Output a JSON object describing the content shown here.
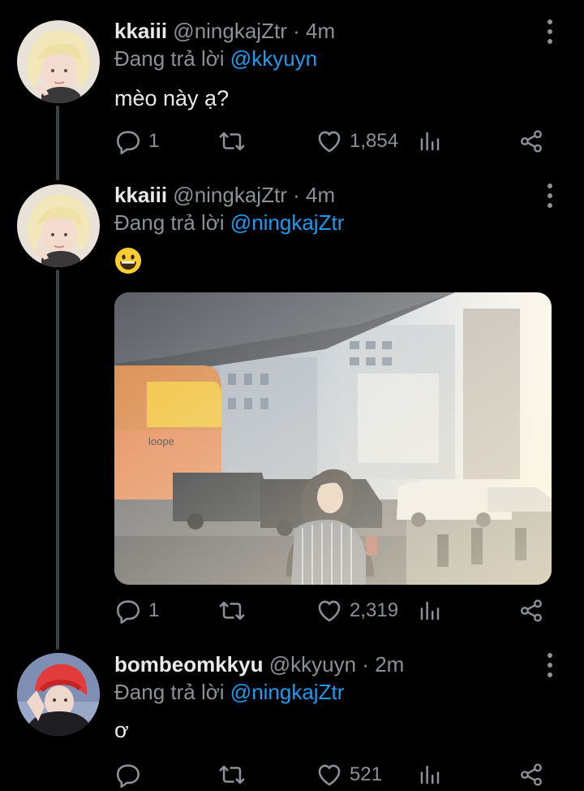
{
  "tweets": [
    {
      "name": "kkaiii",
      "handle": "@ningkajZtr",
      "sep": "·",
      "time": "4m",
      "reply_prefix": "Đang trả lời",
      "reply_to": "@kkyuyn",
      "text": "mèo này ạ?",
      "stats": {
        "replies": "1",
        "likes": "1,854"
      }
    },
    {
      "name": "kkaiii",
      "handle": "@ningkajZtr",
      "sep": "·",
      "time": "4m",
      "reply_prefix": "Đang trả lời",
      "reply_to": "@ningkajZtr",
      "emoji": "grinning-face",
      "media": "photo-street-person",
      "stats": {
        "replies": "1",
        "likes": "2,319"
      }
    },
    {
      "name": "bombeomkkyu",
      "handle": "@kkyuyn",
      "sep": "·",
      "time": "2m",
      "reply_prefix": "Đang trả lời",
      "reply_to": "@ningkajZtr",
      "text": "ơ",
      "stats": {
        "replies": "",
        "likes": "521"
      }
    }
  ],
  "colors": {
    "background": "#000000",
    "text": "#e7e9ea",
    "secondary": "#8b9197",
    "link": "#1d9bf0",
    "thread_line": "#3d4043"
  },
  "icons": [
    "reply-icon",
    "retweet-icon",
    "like-icon",
    "analytics-icon",
    "share-icon",
    "more-options-icon"
  ]
}
